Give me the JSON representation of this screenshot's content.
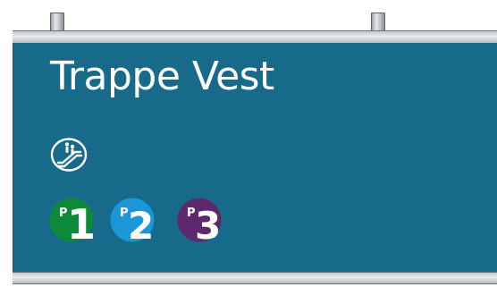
{
  "sign": {
    "title": "Trappe Vest",
    "pictogram": "escalator-icon",
    "parking": [
      {
        "letter": "P",
        "number": "1",
        "color": "#0c8a3a"
      },
      {
        "letter": "P",
        "number": "2",
        "color": "#1a97d6"
      },
      {
        "letter": "P",
        "number": "3",
        "color": "#5c2a6c"
      }
    ]
  },
  "colors": {
    "panel": "#176a8a",
    "text": "#ffffff"
  }
}
